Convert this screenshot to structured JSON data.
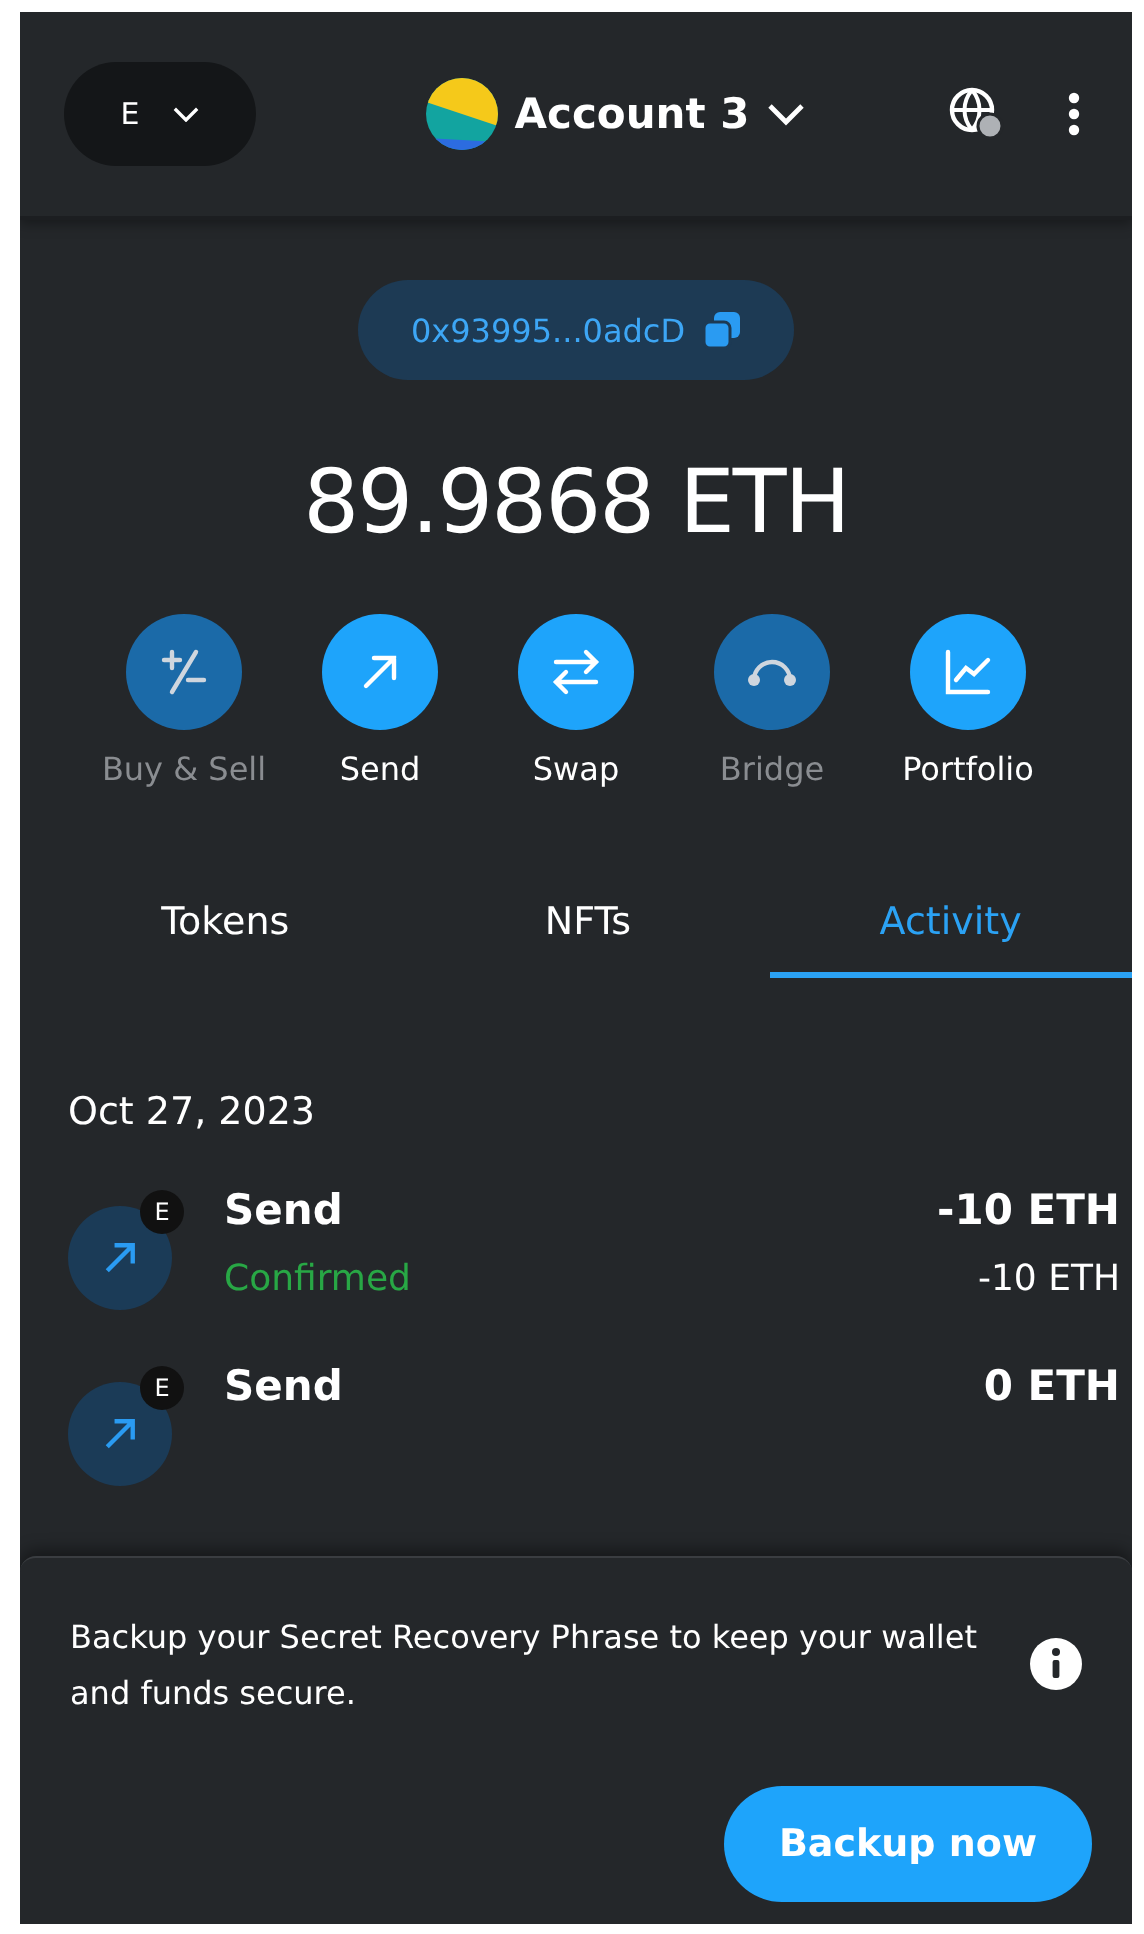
{
  "network": {
    "label": "E"
  },
  "account": {
    "name": "Account 3"
  },
  "address": {
    "text": "0x93995...0adcD"
  },
  "balance": {
    "text": "89.9868 ETH"
  },
  "actions": [
    {
      "label": "Buy & Sell",
      "kind": "buysell",
      "disabled": true
    },
    {
      "label": "Send",
      "kind": "send",
      "disabled": false
    },
    {
      "label": "Swap",
      "kind": "swap",
      "disabled": false
    },
    {
      "label": "Bridge",
      "kind": "bridge",
      "disabled": true
    },
    {
      "label": "Portfolio",
      "kind": "portfolio",
      "disabled": false
    }
  ],
  "tabs": [
    {
      "label": "Tokens",
      "selected": false
    },
    {
      "label": "NFTs",
      "selected": false
    },
    {
      "label": "Activity",
      "selected": true
    }
  ],
  "activity": {
    "date": "Oct 27, 2023",
    "transactions": [
      {
        "title": "Send",
        "badge": "E",
        "status": "Confirmed",
        "color": "#28a745",
        "amount": "-10 ETH",
        "fiat": "-10 ETH"
      },
      {
        "title": "Send",
        "badge": "E",
        "amount": "0 ETH"
      }
    ]
  },
  "banner": {
    "text": "Backup your Secret Recovery Phrase to keep your wallet and funds secure.",
    "button": "Backup now"
  }
}
